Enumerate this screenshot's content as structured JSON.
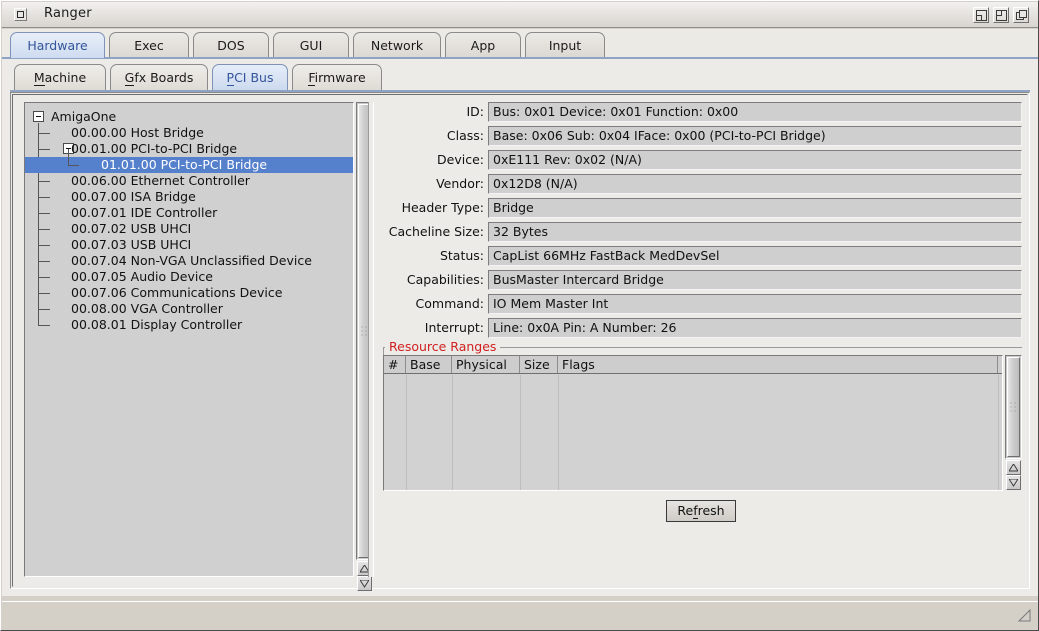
{
  "window": {
    "title": "Ranger",
    "gadgets": [
      "iconify-gadget",
      "resize-gadget",
      "depth-gadget"
    ]
  },
  "main_tabs": [
    {
      "label": "Hardware",
      "accel": "H",
      "active": true
    },
    {
      "label": "Exec",
      "accel": "",
      "active": false
    },
    {
      "label": "DOS",
      "accel": "",
      "active": false
    },
    {
      "label": "GUI",
      "accel": "",
      "active": false
    },
    {
      "label": "Network",
      "accel": "",
      "active": false
    },
    {
      "label": "App",
      "accel": "",
      "active": false
    },
    {
      "label": "Input",
      "accel": "",
      "active": false
    }
  ],
  "sub_tabs": [
    {
      "pre": "M",
      "post": "achine",
      "active": false
    },
    {
      "pre": "G",
      "post": "fx Boards",
      "active": false
    },
    {
      "pre": "P",
      "post": "CI Bus",
      "active": true
    },
    {
      "pre": "F",
      "post": "irmware",
      "active": false
    }
  ],
  "tree": {
    "root": "AmigaOne",
    "nodes": [
      {
        "label": "AmigaOne",
        "depth": 0,
        "expander": true,
        "selected": false
      },
      {
        "label": "00.00.00 Host Bridge",
        "depth": 1,
        "expander": false,
        "selected": false
      },
      {
        "label": "00.01.00 PCI-to-PCI Bridge",
        "depth": 1,
        "expander": true,
        "selected": false
      },
      {
        "label": "01.01.00 PCI-to-PCI Bridge",
        "depth": 2,
        "expander": false,
        "selected": true
      },
      {
        "label": "00.06.00 Ethernet Controller",
        "depth": 1,
        "expander": false,
        "selected": false
      },
      {
        "label": "00.07.00 ISA Bridge",
        "depth": 1,
        "expander": false,
        "selected": false
      },
      {
        "label": "00.07.01 IDE Controller",
        "depth": 1,
        "expander": false,
        "selected": false
      },
      {
        "label": "00.07.02 USB UHCI",
        "depth": 1,
        "expander": false,
        "selected": false
      },
      {
        "label": "00.07.03 USB UHCI",
        "depth": 1,
        "expander": false,
        "selected": false
      },
      {
        "label": "00.07.04 Non-VGA Unclassified Device",
        "depth": 1,
        "expander": false,
        "selected": false
      },
      {
        "label": "00.07.05 Audio Device",
        "depth": 1,
        "expander": false,
        "selected": false
      },
      {
        "label": "00.07.06 Communications Device",
        "depth": 1,
        "expander": false,
        "selected": false
      },
      {
        "label": "00.08.00 VGA Controller",
        "depth": 1,
        "expander": false,
        "selected": false
      },
      {
        "label": "00.08.01 Display Controller",
        "depth": 1,
        "expander": false,
        "selected": false
      }
    ]
  },
  "details": {
    "fields": [
      {
        "label": "ID:",
        "value": "Bus: 0x01 Device: 0x01 Function: 0x00"
      },
      {
        "label": "Class:",
        "value": "Base: 0x06 Sub: 0x04 IFace: 0x00 (PCI-to-PCI Bridge)"
      },
      {
        "label": "Device:",
        "value": "0xE111 Rev: 0x02 (N/A)"
      },
      {
        "label": "Vendor:",
        "value": "0x12D8 (N/A)"
      },
      {
        "label": "Header Type:",
        "value": "Bridge"
      },
      {
        "label": "Cacheline Size:",
        "value": "32 Bytes"
      },
      {
        "label": "Status:",
        "value": "CapList 66MHz FastBack MedDevSel"
      },
      {
        "label": "Capabilities:",
        "value": "BusMaster Intercard Bridge"
      },
      {
        "label": "Command:",
        "value": "IO Mem Master Int"
      },
      {
        "label": "Interrupt:",
        "value": "Line: 0x0A Pin: A Number: 26"
      }
    ]
  },
  "resource_ranges": {
    "group_label": "Resource Ranges",
    "columns": [
      "#",
      "Base",
      "Physical",
      "Size",
      "Flags"
    ],
    "rows": []
  },
  "buttons": {
    "refresh_pre": "Re",
    "refresh_accel": "f",
    "refresh_post": "resh"
  },
  "statusbar": {
    "text": ""
  },
  "colors": {
    "selection": "#5580cc",
    "accent_tab_text": "#33559c",
    "group_label": "#d02020",
    "window_bg": "#d4d0c8",
    "panel_bg": "#ecebe7",
    "field_bg": "#cfcfcf"
  }
}
